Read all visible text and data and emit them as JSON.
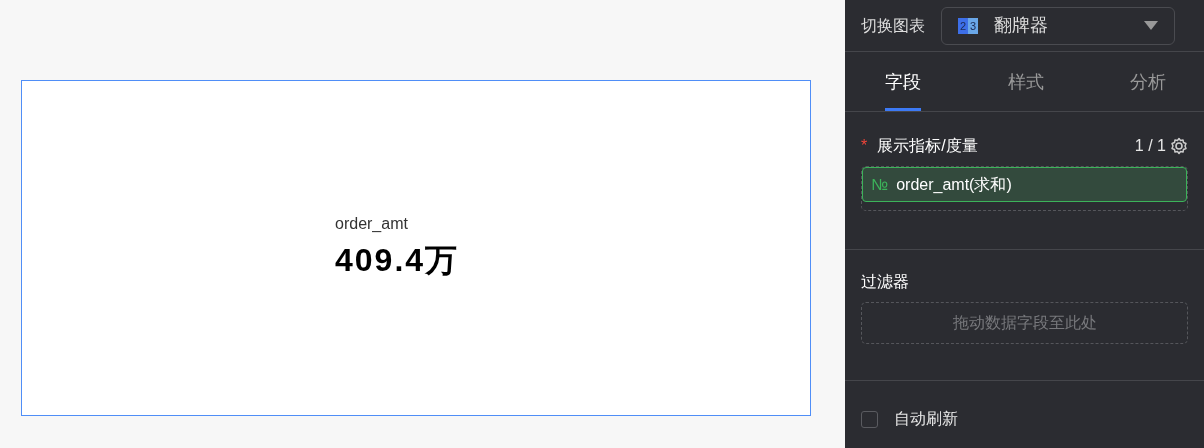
{
  "card": {
    "label": "order_amt",
    "value": "409.4万",
    "selected": true
  },
  "panel": {
    "chart_switch": {
      "label": "切换图表",
      "icon_digits": [
        "2",
        "3"
      ],
      "value": "翻牌器"
    },
    "tabs": [
      {
        "label": "字段",
        "selected": true
      },
      {
        "label": "样式",
        "selected": false
      },
      {
        "label": "分析",
        "selected": false
      }
    ],
    "measure": {
      "required_mark": "*",
      "title": "展示指标/度量",
      "count": "1 / 1",
      "field": {
        "type_mark": "№",
        "name": "order_amt(求和)"
      }
    },
    "filter": {
      "title": "过滤器",
      "placeholder": "拖动数据字段至此处"
    },
    "auto_refresh": {
      "label": "自动刷新",
      "checked": false
    }
  }
}
